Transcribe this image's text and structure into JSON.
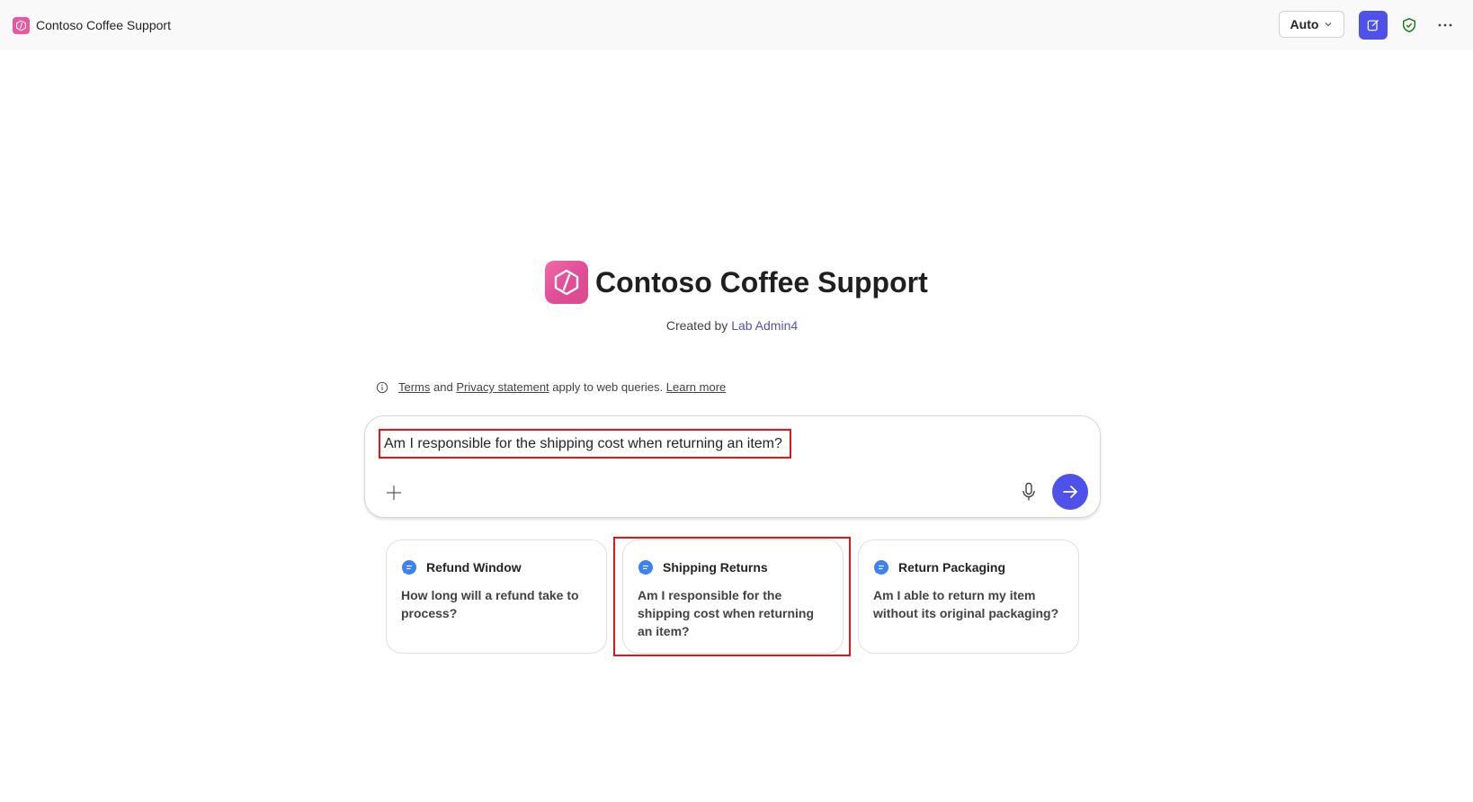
{
  "app": {
    "title": "Contoso Coffee Support",
    "logo_icon": "agent-logo-icon"
  },
  "toolbar": {
    "mode_label": "Auto",
    "mode_chevron_icon": "chevron-down-icon",
    "compose_icon": "new-chat-icon",
    "shield_icon": "shield-check-icon",
    "more_icon": "more-horizontal-icon"
  },
  "hero": {
    "title": "Contoso Coffee Support",
    "created_by_prefix": "Created by",
    "author": "Lab Admin4"
  },
  "notice": {
    "terms": "Terms",
    "and": "and",
    "privacy": "Privacy statement",
    "apply": "apply to web queries.",
    "learn_more": "Learn more"
  },
  "composer": {
    "value": "Am I responsible for the shipping cost when returning an item?",
    "attach_icon": "plus-icon",
    "mic_icon": "microphone-icon",
    "send_icon": "arrow-right-icon"
  },
  "suggestions": [
    {
      "title": "Refund Window",
      "prompt": "How long will a refund take to process?"
    },
    {
      "title": "Shipping Returns",
      "prompt": "Am I responsible for the shipping cost when returning an item?"
    },
    {
      "title": "Return Packaging",
      "prompt": "Am I able to return my item without its original packaging?"
    }
  ],
  "colors": {
    "accent": "#4f52e8",
    "brand_pink": "#e14e9a",
    "highlight": "#e8131b",
    "author_link": "#4f52b2",
    "shield_green": "#107c10"
  }
}
